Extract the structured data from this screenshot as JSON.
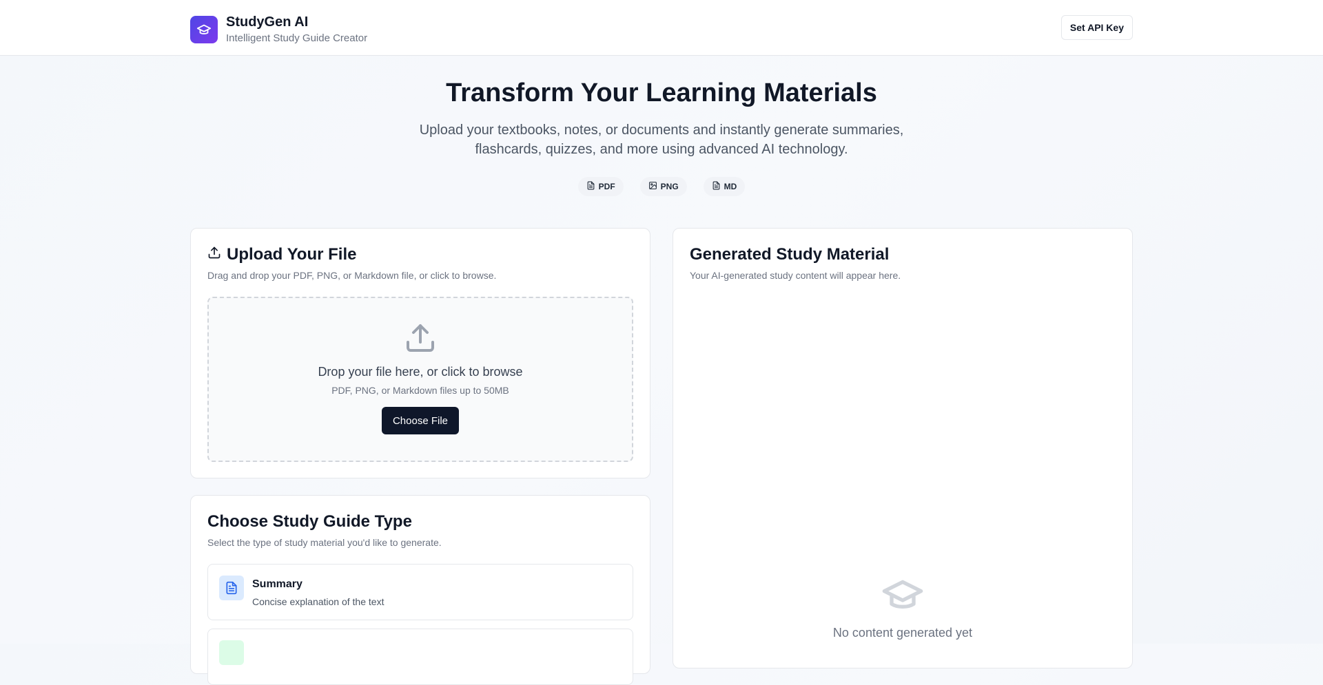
{
  "header": {
    "app_name": "StudyGen AI",
    "tagline": "Intelligent Study Guide Creator",
    "api_button_label": "Set API Key",
    "logo_icon": "graduation-cap-icon"
  },
  "hero": {
    "title": "Transform Your Learning Materials",
    "description": "Upload your textbooks, notes, or documents and instantly generate summaries, flashcards, quizzes, and more using advanced AI technology.",
    "formats": [
      {
        "label": "PDF",
        "icon": "file-text-icon"
      },
      {
        "label": "PNG",
        "icon": "image-icon"
      },
      {
        "label": "MD",
        "icon": "file-text-icon"
      }
    ]
  },
  "upload": {
    "title": "Upload Your File",
    "subtitle": "Drag and drop your PDF, PNG, or Markdown file, or click to browse.",
    "drop_title": "Drop your file here, or click to browse",
    "drop_hint": "PDF, PNG, or Markdown files up to 50MB",
    "button_label": "Choose File"
  },
  "guide_type": {
    "title": "Choose Study Guide Type",
    "subtitle": "Select the type of study material you'd like to generate.",
    "options": [
      {
        "title": "Summary",
        "description": "Concise explanation of the text",
        "icon": "file-text-icon",
        "color": "#2563eb",
        "bg": "#dbeafe"
      },
      {
        "title": "",
        "description": "",
        "icon": "",
        "color": "#16a34a",
        "bg": "#dcfce7"
      }
    ]
  },
  "output": {
    "title": "Generated Study Material",
    "subtitle": "Your AI-generated study content will appear here.",
    "empty_text": "No content generated yet",
    "empty_icon": "graduation-cap-icon"
  },
  "colors": {
    "primary": "#0f172a",
    "brand_gradient_start": "#4f46e5",
    "brand_gradient_end": "#7c3aed"
  }
}
